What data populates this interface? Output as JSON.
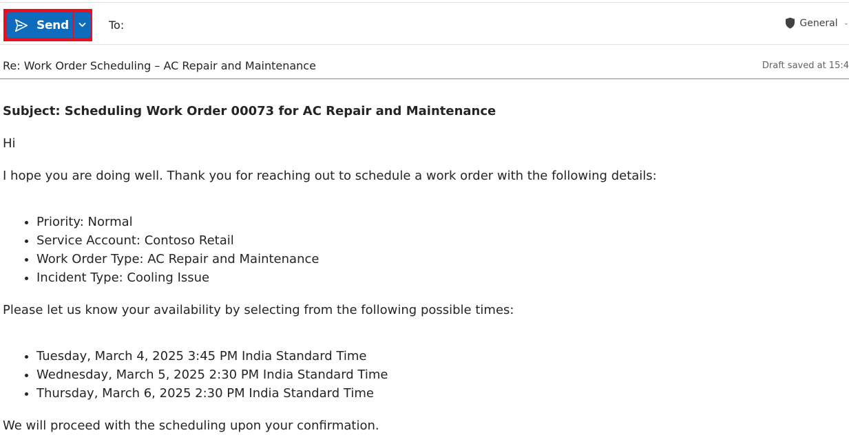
{
  "toolbar": {
    "send_label": "Send",
    "to_label": "To:",
    "sensitivity_label": "General"
  },
  "subject_field": {
    "value": "Re: Work Order Scheduling – AC Repair and Maintenance",
    "draft_status": "Draft saved at 15:4"
  },
  "body": {
    "subject_line": "Subject: Scheduling Work Order 00073 for AC Repair and Maintenance",
    "greeting": "Hi",
    "intro": "I hope you are doing well. Thank you for reaching out to schedule a work order with the following details:",
    "details": [
      "Priority: Normal",
      "Service Account: Contoso Retail",
      "Work Order Type: AC Repair and Maintenance",
      "Incident Type: Cooling Issue"
    ],
    "availability_prompt": "Please let us know your availability by selecting from the following possible times:",
    "times": [
      "Tuesday, March 4, 2025 3:45 PM India Standard Time",
      "Wednesday, March 5, 2025 2:30 PM India Standard Time",
      "Thursday, March 6, 2025 2:30 PM India Standard Time"
    ],
    "closing": "We will proceed with the scheduling upon your confirmation."
  },
  "colors": {
    "send_blue": "#0f6cbd",
    "highlight_red": "#e81123"
  },
  "icons": {
    "send": "send-icon",
    "dropdown": "chevron-down-icon",
    "sensitivity": "shield-icon"
  }
}
